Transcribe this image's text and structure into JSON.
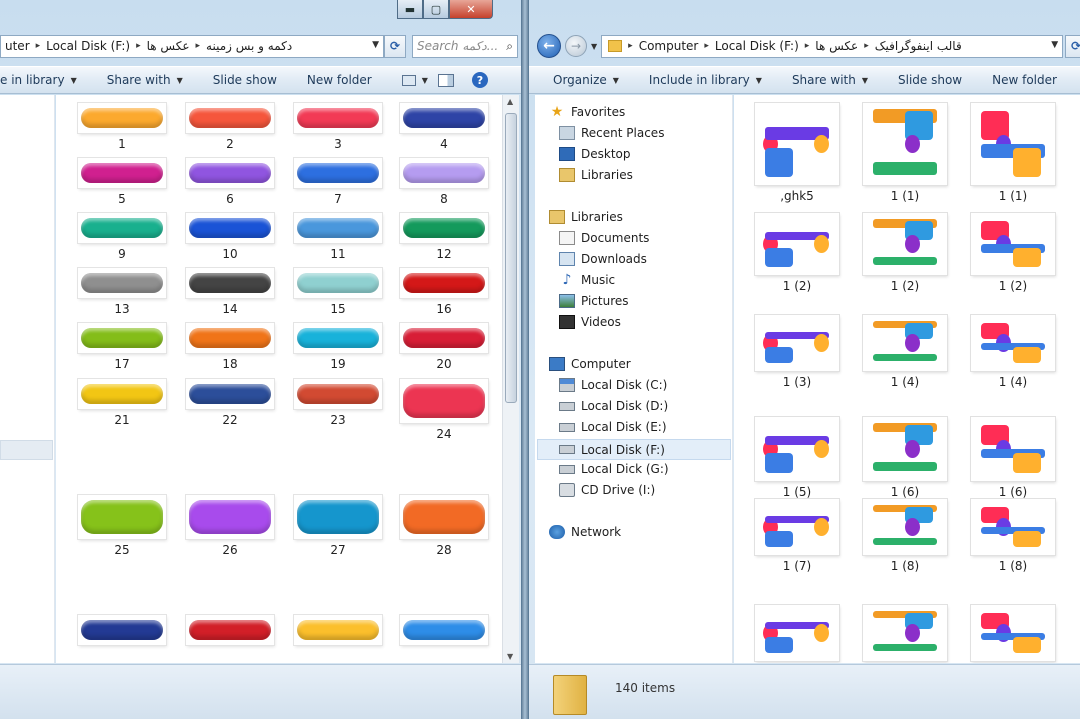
{
  "left": {
    "caption_min": "▬",
    "caption_max": "▢",
    "caption_close": "✕",
    "address": {
      "crumbs": [
        "uter",
        "Local Disk (F:)",
        "عکس ها",
        "دکمه و بس زمینه"
      ]
    },
    "search_placeholder": "Search دکمه...",
    "toolbar": {
      "include_label": "e in library",
      "share_label": "Share with",
      "slideshow_label": "Slide show",
      "newfolder_label": "New folder"
    },
    "buttons": [
      {
        "label": "1",
        "color": "#fca92e"
      },
      {
        "label": "2",
        "color": "#f5563c"
      },
      {
        "label": "3",
        "color": "#f23a55"
      },
      {
        "label": "4",
        "color": "#2e44a6"
      },
      {
        "label": "5",
        "color": "#d0208f"
      },
      {
        "label": "6",
        "color": "#9055e0"
      },
      {
        "label": "7",
        "color": "#2d6fe0"
      },
      {
        "label": "8",
        "color": "#b59cf0"
      },
      {
        "label": "9",
        "color": "#19b08e"
      },
      {
        "label": "10",
        "color": "#1a53d6"
      },
      {
        "label": "11",
        "color": "#4a97dc"
      },
      {
        "label": "12",
        "color": "#149a5c"
      },
      {
        "label": "13",
        "color": "#8f8f8f"
      },
      {
        "label": "14",
        "color": "#444444"
      },
      {
        "label": "15",
        "color": "#8fd0d0"
      },
      {
        "label": "16",
        "color": "#d41818"
      },
      {
        "label": "17",
        "color": "#84bd19"
      },
      {
        "label": "18",
        "color": "#f07418"
      },
      {
        "label": "19",
        "color": "#18b2da"
      },
      {
        "label": "20",
        "color": "#d81e36"
      },
      {
        "label": "21",
        "color": "#f2c614"
      },
      {
        "label": "22",
        "color": "#2c4e9a"
      },
      {
        "label": "23",
        "color": "#d24a32"
      },
      {
        "label": "24",
        "color": "#ec3552"
      },
      {
        "label": "25",
        "color": "#86c21a"
      },
      {
        "label": "26",
        "color": "#a84bec"
      },
      {
        "label": "27",
        "color": "#1596cd"
      },
      {
        "label": "28",
        "color": "#f26a25"
      },
      {
        "label": "",
        "color": "#233a94"
      },
      {
        "label": "",
        "color": "#d21f28"
      },
      {
        "label": "",
        "color": "#fbbf2c"
      },
      {
        "label": "",
        "color": "#2e8de8"
      }
    ]
  },
  "right": {
    "address": {
      "crumbs": [
        "Computer",
        "Local Disk (F:)",
        "عکس ها",
        "قالب اینفوگرافیک"
      ]
    },
    "toolbar": {
      "organize_label": "Organize",
      "include_label": "Include in library",
      "share_label": "Share with",
      "slideshow_label": "Slide show",
      "newfolder_label": "New folder"
    },
    "nav": {
      "favorites": "Favorites",
      "recent_places": "Recent Places",
      "desktop": "Desktop",
      "libraries_fav": "Libraries",
      "libraries": "Libraries",
      "documents": "Documents",
      "downloads": "Downloads",
      "music": "Music",
      "pictures": "Pictures",
      "videos": "Videos",
      "computer": "Computer",
      "disk_c": "Local Disk (C:)",
      "disk_d": "Local Disk (D:)",
      "disk_e": "Local Disk (E:)",
      "disk_f": "Local Disk (F:)",
      "disk_g": "Local Dick (G:)",
      "cd": "CD Drive (I:)",
      "network": "Network"
    },
    "files": [
      {
        "label": ",ghk5"
      },
      {
        "label": "1 (1)"
      },
      {
        "label": "1 (1)"
      },
      {
        "label": "1 (2)"
      },
      {
        "label": "1 (2)"
      },
      {
        "label": "1 (2)"
      },
      {
        "label": "1 (3)"
      },
      {
        "label": "1 (4)"
      },
      {
        "label": "1 (4)"
      },
      {
        "label": "1 (5)"
      },
      {
        "label": "1 (6)"
      },
      {
        "label": "1 (6)"
      },
      {
        "label": "1 (7)"
      },
      {
        "label": "1 (8)"
      },
      {
        "label": "1 (8)"
      },
      {
        "label": ""
      },
      {
        "label": ""
      },
      {
        "label": ""
      }
    ],
    "status": {
      "count": "140 items"
    }
  }
}
